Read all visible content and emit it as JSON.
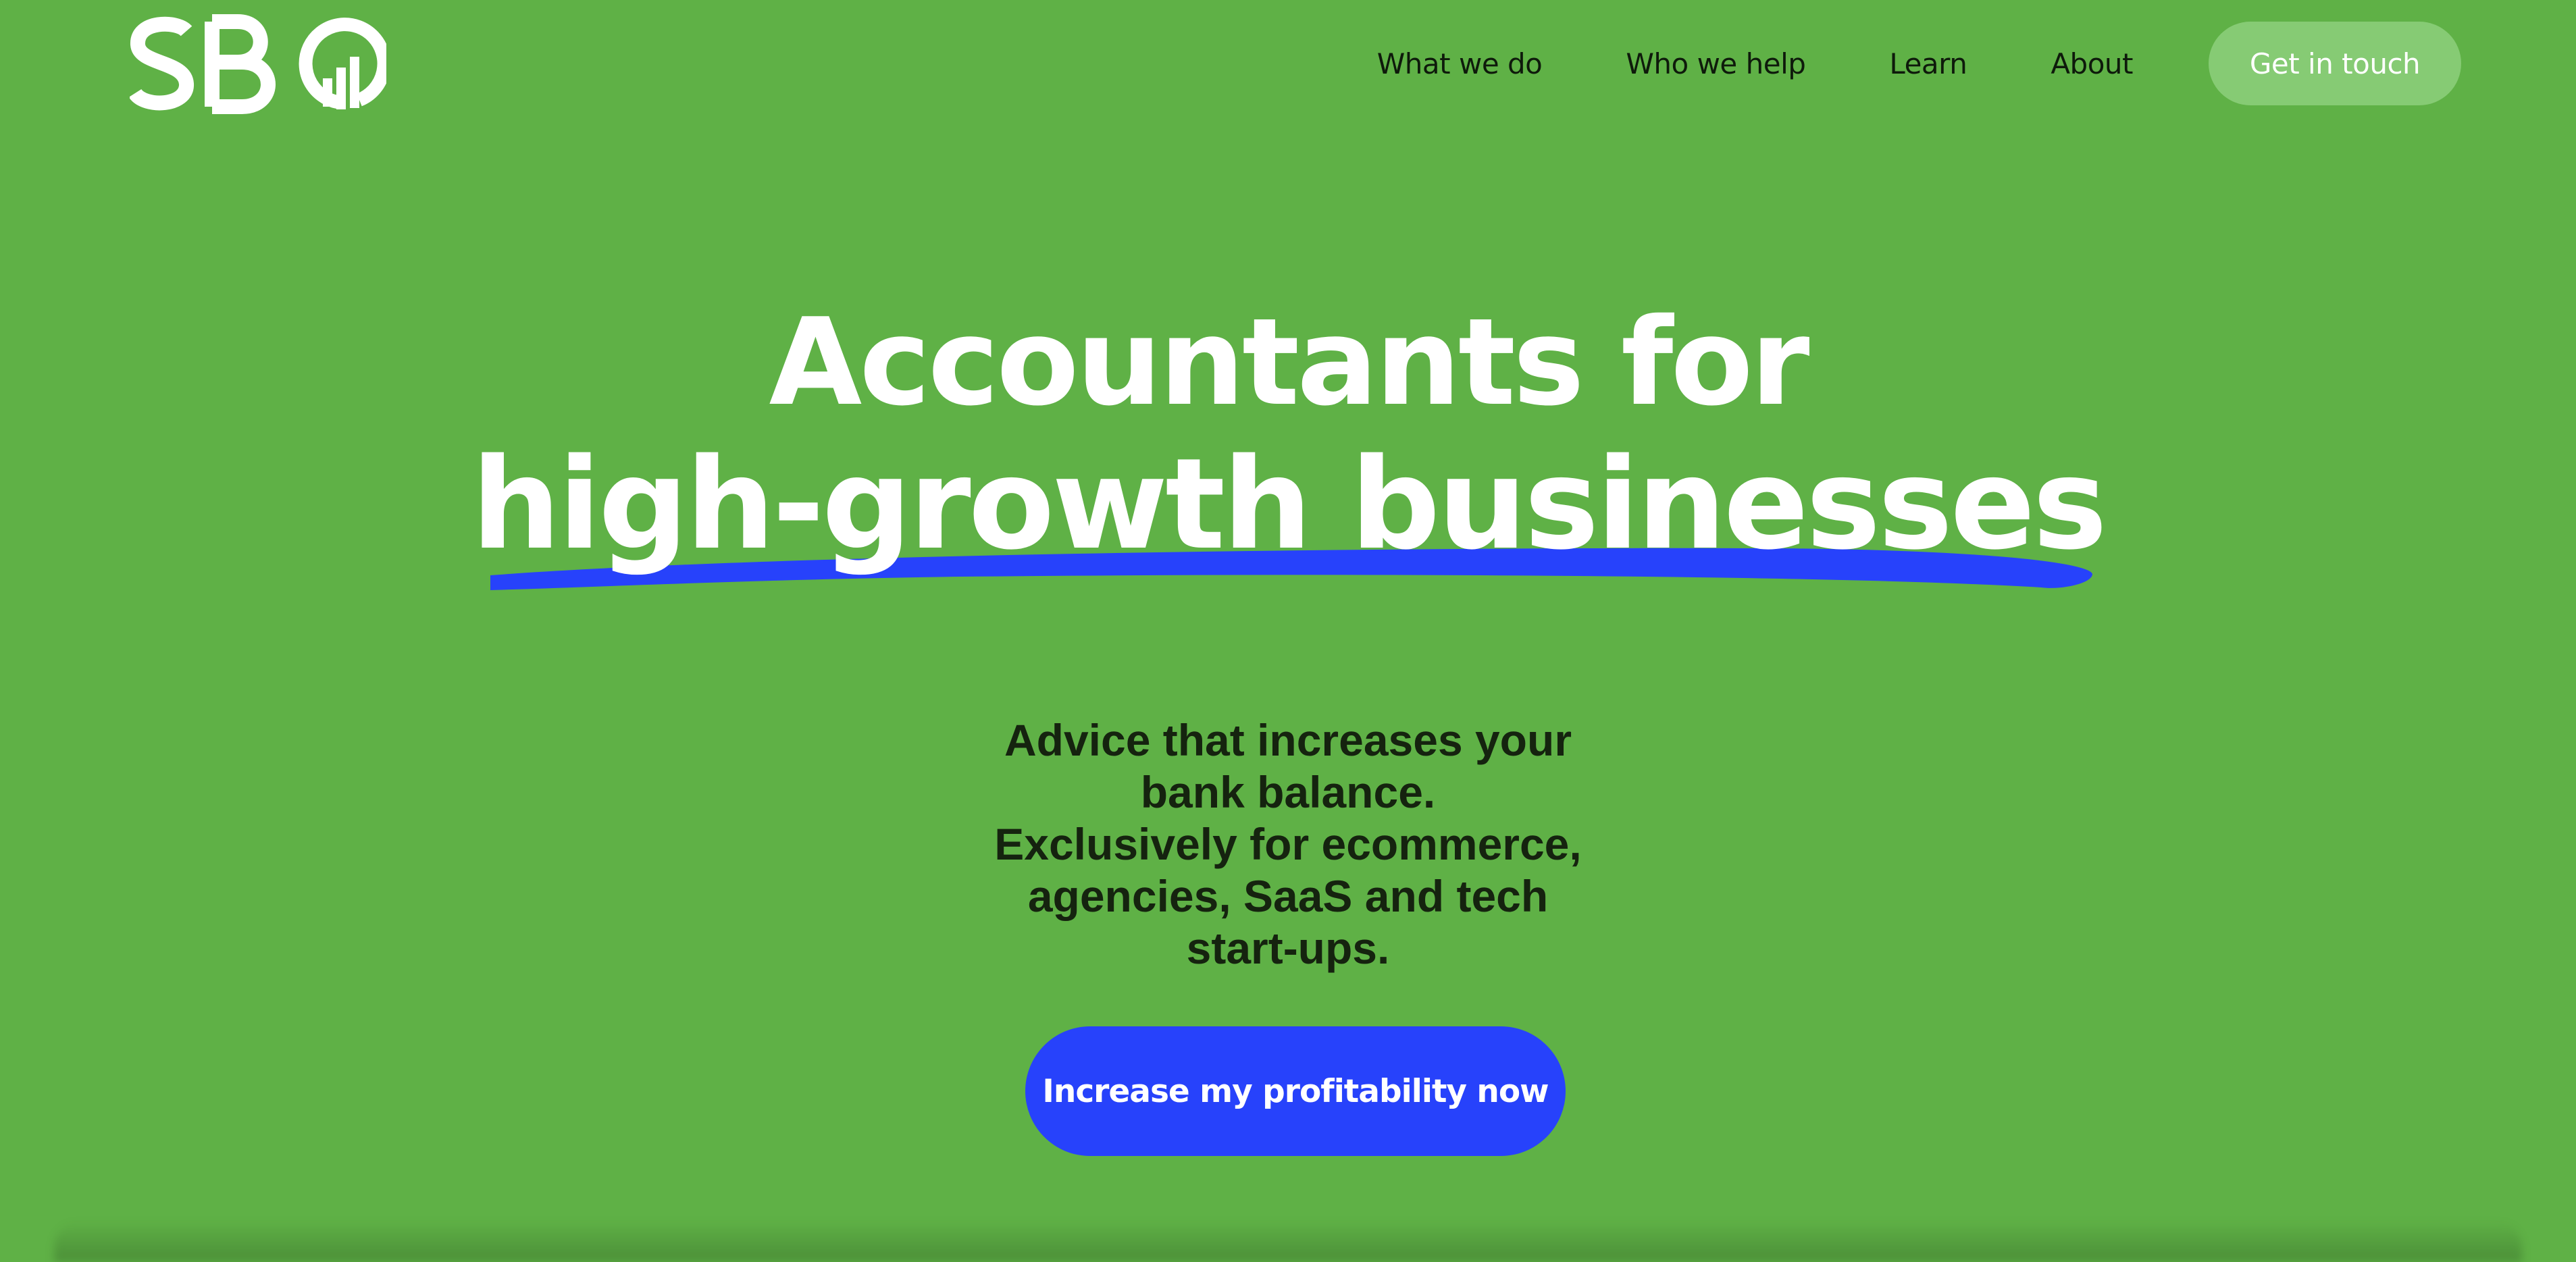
{
  "brand": {
    "logo_text": "SBO",
    "background_color": "#5fb146",
    "accent_color": "#2742fb",
    "secondary_button_color": "#86cb74"
  },
  "nav": {
    "items": [
      {
        "label": "What we do"
      },
      {
        "label": "Who we help"
      },
      {
        "label": "Learn"
      },
      {
        "label": "About"
      }
    ],
    "cta_label": "Get in touch"
  },
  "hero": {
    "headline_line1": "Accountants for",
    "headline_line2": "high-growth businesses",
    "subtitle_lines": [
      "Advice that increases your",
      "bank balance.",
      "Exclusively for ecommerce,",
      "agencies, SaaS and tech",
      "start-ups."
    ],
    "cta_label": "Increase my profitability now"
  }
}
